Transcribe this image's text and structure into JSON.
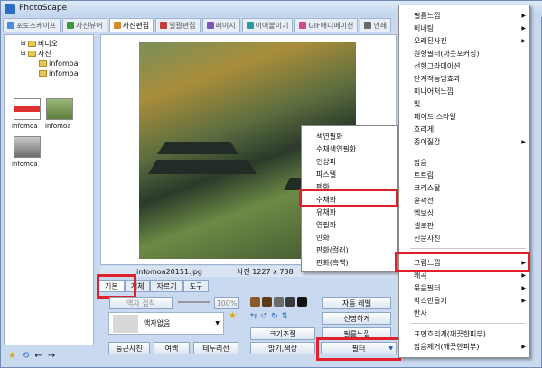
{
  "app": {
    "title": "PhotoScape"
  },
  "top_tabs": [
    {
      "label": "포토스케이프",
      "color": "#4a8fd8"
    },
    {
      "label": "사진뷰어",
      "color": "#3c9c3c"
    },
    {
      "label": "사진편집",
      "color": "#d28a2a"
    },
    {
      "label": "일괄편집",
      "color": "#c23c3c"
    },
    {
      "label": "페이지",
      "color": "#7a56b8"
    },
    {
      "label": "이어붙이기",
      "color": "#2a9a9a"
    },
    {
      "label": "GIF애니메이션",
      "color": "#d24a8a"
    },
    {
      "label": "인쇄",
      "color": "#6a6a6a"
    }
  ],
  "tree": {
    "video": "비디오",
    "photos": "사진",
    "sub1": "infomoa",
    "sub2": "infomoa"
  },
  "thumbs": [
    {
      "label": "infomoa"
    },
    {
      "label": "infomoa"
    },
    {
      "label": "infomoa"
    }
  ],
  "status": {
    "filename": "infomoa20151.jpg",
    "size": "사진 1227 x 738"
  },
  "bottom_tabs": [
    "기본",
    "개체",
    "자르기",
    "도구"
  ],
  "controls": {
    "frame_merge": "액자 접착",
    "zoom": "100%",
    "frame_select": "액자없음",
    "round_photo": "둥근사진",
    "margin": "여백",
    "border": "테두리선",
    "auto_level": "자동 레벨",
    "sharpen": "선명하게",
    "resize": "크기조절",
    "film_effect": "필름느낌",
    "brightness": "밝기,색상",
    "filter": "필터"
  },
  "submenu": {
    "items": [
      "색연필화",
      "수채색연필화",
      "인상파",
      "파스텔",
      "펜화",
      "수채화",
      "유채화",
      "연필화",
      "만화",
      "판화(컬러)",
      "판화(흑백)"
    ]
  },
  "filter_menu": {
    "items": [
      {
        "label": "필름느낌",
        "arrow": true
      },
      {
        "label": "비네팅",
        "arrow": true
      },
      {
        "label": "오래된사진",
        "arrow": true
      },
      {
        "label": "원형필터(아웃포커싱)",
        "arrow": false
      },
      {
        "label": "선형그라데이션",
        "arrow": false
      },
      {
        "label": "단계적농담효과",
        "arrow": false
      },
      {
        "label": "미니어처느낌",
        "arrow": false
      },
      {
        "label": "빛",
        "arrow": false
      },
      {
        "label": "페이드 스타일",
        "arrow": false
      },
      {
        "label": "흐리게",
        "arrow": false
      },
      {
        "label": "종이질감",
        "arrow": true
      },
      {
        "label": "잡음",
        "arrow": false
      },
      {
        "label": "트트림",
        "arrow": false
      },
      {
        "label": "크리스탈",
        "arrow": false
      },
      {
        "label": "윤곽선",
        "arrow": false
      },
      {
        "label": "엠보싱",
        "arrow": false
      },
      {
        "label": "셀로판",
        "arrow": false
      },
      {
        "label": "신문사진",
        "arrow": false
      },
      {
        "label": "그림느낌",
        "arrow": true
      },
      {
        "label": "왜곡",
        "arrow": true
      },
      {
        "label": "묶음필터",
        "arrow": true
      },
      {
        "label": "박스만들기",
        "arrow": true
      },
      {
        "label": "반사",
        "arrow": false
      },
      {
        "label": "표면흐리게(깨끗한피부)",
        "arrow": false
      },
      {
        "label": "잡음제거(깨끗한피부)",
        "arrow": true
      }
    ]
  },
  "colors": {
    "highlight": "#e0212b"
  }
}
